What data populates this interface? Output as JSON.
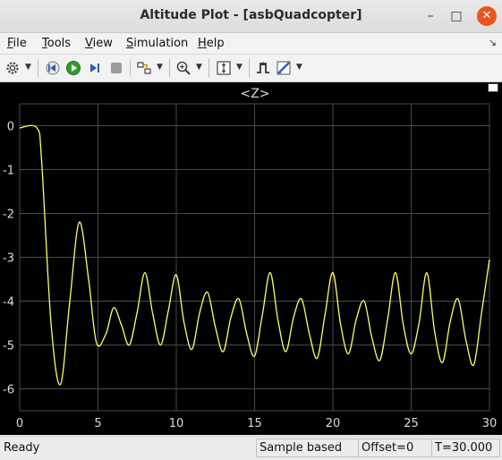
{
  "window": {
    "title": "Altitude Plot - [asbQuadcopter]",
    "controls": {
      "minimize": "–",
      "maximize": "□",
      "close": "✕"
    }
  },
  "menu": {
    "items": [
      {
        "ul": "F",
        "rest": "ile"
      },
      {
        "ul": "T",
        "rest": "ools"
      },
      {
        "ul": "V",
        "rest": "iew"
      },
      {
        "ul": "S",
        "rest": "imulation"
      },
      {
        "ul": "H",
        "rest": "elp"
      }
    ],
    "corner_icon": "dock-arrow-icon"
  },
  "toolbar": {
    "icons": [
      "gear-icon",
      "step-back-icon",
      "run-icon",
      "step-forward-icon",
      "stop-icon",
      "signal-selector-icon",
      "zoom-icon",
      "scale-axes-icon",
      "triggers-icon",
      "measurements-icon"
    ],
    "colors": {
      "run": "#2e9d2e",
      "step": "#2a5db8",
      "stop": "#9a9a9a"
    }
  },
  "plot": {
    "title": "<Z>",
    "background": "#000000",
    "grid_color": "#4a4a4a",
    "line_color": "#ffff66",
    "text_color": "#dcdcdc"
  },
  "chart_data": {
    "type": "line",
    "title": "<Z>",
    "xlabel": "",
    "ylabel": "",
    "xlim": [
      0,
      30
    ],
    "ylim": [
      -6.5,
      0.5
    ],
    "x_ticks": [
      "0",
      "5",
      "10",
      "15",
      "20",
      "25",
      "30"
    ],
    "y_ticks": [
      "0",
      "-1",
      "-2",
      "-3",
      "-4",
      "-5",
      "-6"
    ],
    "grid": true,
    "series": [
      {
        "x": [
          0,
          1.1,
          1.4,
          2.0,
          2.6,
          3.2,
          3.8,
          4.4,
          4.9,
          5.5,
          6.0,
          6.5,
          7.0,
          7.5,
          8.0,
          8.5,
          9.0,
          9.5,
          10.0,
          10.5,
          11.0,
          11.5,
          12.0,
          12.5,
          13.0,
          13.5,
          14.0,
          14.5,
          15.0,
          15.5,
          16.0,
          16.5,
          17.0,
          17.5,
          18.0,
          18.5,
          19.0,
          19.5,
          20.0,
          20.5,
          21.0,
          21.5,
          22.0,
          22.5,
          23.0,
          23.5,
          24.0,
          24.5,
          25.0,
          25.5,
          26.0,
          26.5,
          27.0,
          27.5,
          28.0,
          28.5,
          29.0,
          29.5,
          30.0
        ],
        "y": [
          -0.05,
          -0.05,
          -0.8,
          -4.5,
          -5.9,
          -4.0,
          -2.2,
          -3.5,
          -4.95,
          -4.75,
          -4.15,
          -4.55,
          -5.0,
          -4.25,
          -3.35,
          -4.3,
          -5.0,
          -4.2,
          -3.4,
          -4.5,
          -5.1,
          -4.25,
          -3.8,
          -4.6,
          -5.15,
          -4.35,
          -3.95,
          -4.75,
          -5.25,
          -4.3,
          -3.35,
          -4.45,
          -5.15,
          -4.35,
          -3.95,
          -4.75,
          -5.3,
          -4.3,
          -3.35,
          -4.55,
          -5.2,
          -4.4,
          -4.0,
          -4.85,
          -5.35,
          -4.4,
          -3.35,
          -4.55,
          -5.2,
          -4.5,
          -3.35,
          -4.7,
          -5.4,
          -4.45,
          -3.95,
          -4.9,
          -5.45,
          -4.25,
          -3.05
        ]
      }
    ]
  },
  "status": {
    "state": "Ready",
    "mode": "Sample based",
    "offset": "Offset=0",
    "time": "T=30.000"
  }
}
